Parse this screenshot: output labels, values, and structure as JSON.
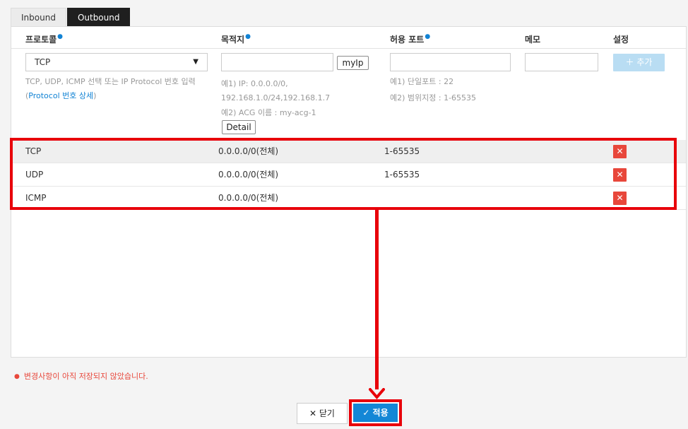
{
  "tabs": [
    {
      "label": "Inbound",
      "active": false
    },
    {
      "label": "Outbound",
      "active": true
    }
  ],
  "headers": {
    "protocol": "프로토콜",
    "destination": "목적지",
    "port": "허용 포트",
    "memo": "메모",
    "settings": "설정",
    "required_mark": "●"
  },
  "form": {
    "protocol_value": "TCP",
    "protocol_help_1": "TCP, UDP, ICMP 선택 또는 IP Protocol 번호 입력",
    "protocol_help_link_open": "(",
    "protocol_help_link": "Protocol 번호 상세",
    "protocol_help_link_close": ")",
    "myip_label": "myIp",
    "dest_help_1": "예1) IP: 0.0.0.0/0,",
    "dest_help_2": "192.168.1.0/24,192.168.1.7",
    "dest_help_3": "예2) ACG 이름 : my-acg-1",
    "detail_label": "Detail",
    "port_help_1": "예1) 단일포트 : 22",
    "port_help_2": "예2) 범위지정 : 1-65535",
    "add_label": "＋ 추가"
  },
  "rules": [
    {
      "protocol": "TCP",
      "destination": "0.0.0.0/0(전체)",
      "port": "1-65535",
      "memo": ""
    },
    {
      "protocol": "UDP",
      "destination": "0.0.0.0/0(전체)",
      "port": "1-65535",
      "memo": ""
    },
    {
      "protocol": "ICMP",
      "destination": "0.0.0.0/0(전체)",
      "port": "",
      "memo": ""
    }
  ],
  "delete_icon": "✕",
  "warning": "변경사항이 아직 저장되지 않았습니다.",
  "footer": {
    "close_label": "✕  닫기",
    "apply_label": "✓ 적용"
  },
  "colors": {
    "annotation": "#e8000a",
    "accent": "#1487d6",
    "delete": "#e8473b"
  }
}
